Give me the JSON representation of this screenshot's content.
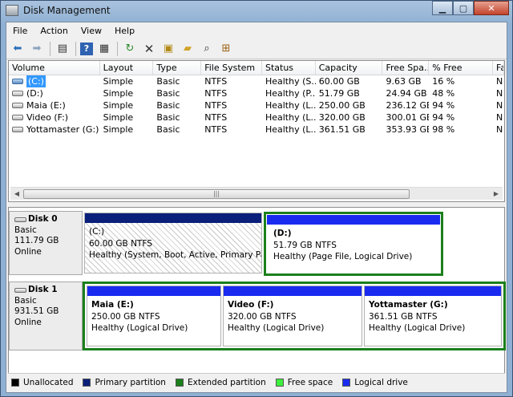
{
  "window": {
    "title": "Disk Management",
    "buttons": [
      "minimize",
      "maximize",
      "close"
    ]
  },
  "menu": [
    "File",
    "Action",
    "View",
    "Help"
  ],
  "toolbar": [
    "back-icon",
    "forward-icon",
    "console-icon",
    "help-icon",
    "properties-icon",
    "refresh-icon",
    "delete-icon",
    "checkmark-folder-icon",
    "open-folder-icon",
    "search-icon",
    "export-icon"
  ],
  "columns": [
    "Volume",
    "Layout",
    "Type",
    "File System",
    "Status",
    "Capacity",
    "Free Spa...",
    "% Free",
    "Fa"
  ],
  "volumes": [
    {
      "name": "(C:)",
      "layout": "Simple",
      "type": "Basic",
      "fs": "NTFS",
      "status": "Healthy (S...",
      "capacity": "60.00 GB",
      "free": "9.63 GB",
      "pct": "16 %",
      "fa": "N",
      "selected": true
    },
    {
      "name": "(D:)",
      "layout": "Simple",
      "type": "Basic",
      "fs": "NTFS",
      "status": "Healthy (P...",
      "capacity": "51.79 GB",
      "free": "24.94 GB",
      "pct": "48 %",
      "fa": "N"
    },
    {
      "name": "Maia (E:)",
      "layout": "Simple",
      "type": "Basic",
      "fs": "NTFS",
      "status": "Healthy (L...",
      "capacity": "250.00 GB",
      "free": "236.12 GB",
      "pct": "94 %",
      "fa": "N"
    },
    {
      "name": "Video (F:)",
      "layout": "Simple",
      "type": "Basic",
      "fs": "NTFS",
      "status": "Healthy (L...",
      "capacity": "320.00 GB",
      "free": "300.01 GB",
      "pct": "94 %",
      "fa": "N"
    },
    {
      "name": "Yottamaster (G:)",
      "layout": "Simple",
      "type": "Basic",
      "fs": "NTFS",
      "status": "Healthy (L...",
      "capacity": "361.51 GB",
      "free": "353.93 GB",
      "pct": "98 %",
      "fa": "N"
    }
  ],
  "disks": [
    {
      "name": "Disk 0",
      "kind": "Basic",
      "size": "111.79 GB",
      "state": "Online",
      "partitions": [
        {
          "name": "(C:)",
          "size": "60.00 GB NTFS",
          "status": "Healthy (System, Boot, Active, Primary Partiti"
        },
        {
          "name": "(D:)",
          "size": "51.79 GB NTFS",
          "status": "Healthy (Page File, Logical Drive)"
        }
      ]
    },
    {
      "name": "Disk 1",
      "kind": "Basic",
      "size": "931.51 GB",
      "state": "Online",
      "partitions": [
        {
          "name": "Maia  (E:)",
          "size": "250.00 GB NTFS",
          "status": "Healthy (Logical Drive)"
        },
        {
          "name": "Video  (F:)",
          "size": "320.00 GB NTFS",
          "status": "Healthy (Logical Drive)"
        },
        {
          "name": "Yottamaster  (G:)",
          "size": "361.51 GB NTFS",
          "status": "Healthy (Logical Drive)"
        }
      ]
    }
  ],
  "legend": [
    {
      "label": "Unallocated",
      "color": "#000000"
    },
    {
      "label": "Primary partition",
      "color": "#0a1f7a"
    },
    {
      "label": "Extended partition",
      "color": "#1b7f1b"
    },
    {
      "label": "Free space",
      "color": "#3cf03c"
    },
    {
      "label": "Logical drive",
      "color": "#1a2bef"
    }
  ],
  "colors": {
    "primary": "#0a1f7a",
    "logical": "#1a2bef",
    "extended": "#1b7f1b",
    "selection": "#3399ff"
  }
}
